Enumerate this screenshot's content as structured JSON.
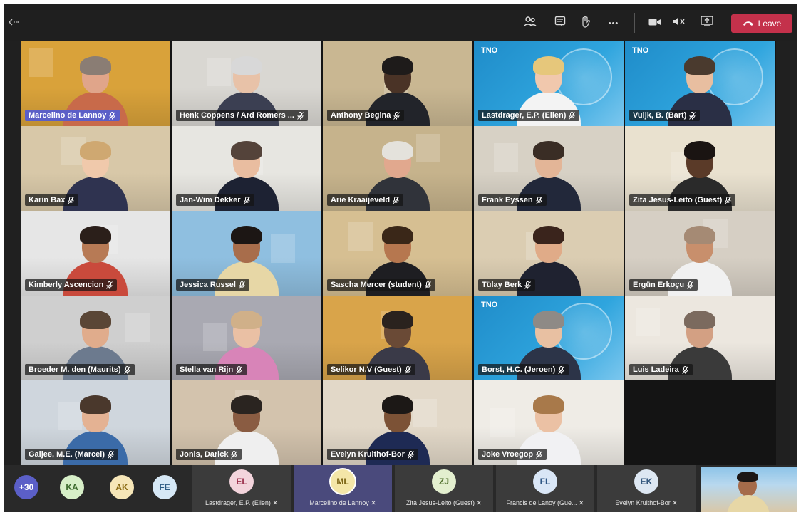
{
  "topbar": {
    "icons": [
      "participants-icon",
      "chat-icon",
      "raise-hand-icon",
      "more-options-icon",
      "camera-icon",
      "mute-icon",
      "share-screen-icon"
    ],
    "leave_label": "Leave",
    "more_glyph": "•••",
    "leave_color": "#c4314b"
  },
  "participants": [
    {
      "name": "Marcelino de Lannoy",
      "speaking": true,
      "bg": "#d9a23a",
      "skin": "#e0a58a",
      "hair": "#8a7d74",
      "shirt": "#c86a4a"
    },
    {
      "name": "Henk Coppens / Ard Romers ...",
      "bg": "#d9d7d2",
      "skin": "#e8c2a8",
      "hair": "#d8d8d8",
      "shirt": "#3b3f52"
    },
    {
      "name": "Anthony Begina",
      "bg": "#c9b792",
      "skin": "#4a3326",
      "hair": "#1e1b1a",
      "shirt": "#22242a"
    },
    {
      "name": "Lastdrager, E.P. (Ellen)",
      "bg": "#1f8cc9",
      "skin": "#f1c8ad",
      "hair": "#e6c77b",
      "shirt": "#f3f3f3",
      "tno": true
    },
    {
      "name": "Vuijk, B. (Bart)",
      "bg": "#1f8cc9",
      "skin": "#e8bea0",
      "hair": "#4a3a2e",
      "shirt": "#2a2f45",
      "tno": true
    },
    {
      "name": "Karin Bax",
      "bg": "#d8c8a8",
      "skin": "#f0c9ab",
      "hair": "#cfa871",
      "shirt": "#2f3350"
    },
    {
      "name": "Jan-Wim Dekker",
      "bg": "#e7e6e1",
      "skin": "#e9bda0",
      "hair": "#54433a",
      "shirt": "#1d2233"
    },
    {
      "name": "Arie Kraaijeveld",
      "bg": "#c6b38c",
      "skin": "#e1a88e",
      "hair": "#e4e2dc",
      "shirt": "#30333a"
    },
    {
      "name": "Frank Eyssen",
      "bg": "#d7d1c5",
      "skin": "#e3b597",
      "hair": "#3a2d25",
      "shirt": "#22283a"
    },
    {
      "name": "Zita Jesus-Leito (Guest)",
      "bg": "#e9e1cf",
      "skin": "#5a3a28",
      "hair": "#1a1412",
      "shirt": "#2a2a2a"
    },
    {
      "name": "Kimberly Ascencion",
      "bg": "#e6e6e6",
      "skin": "#b77a55",
      "hair": "#2b1f1a",
      "shirt": "#c94a3c"
    },
    {
      "name": "Jessica Russel",
      "bg": "#8fbfe0",
      "skin": "#a86d4b",
      "hair": "#1c1614",
      "shirt": "#e7d7a6"
    },
    {
      "name": "Sascha Mercer (student)",
      "bg": "#d6bf92",
      "skin": "#b6774f",
      "hair": "#3a2718",
      "shirt": "#1e1e22"
    },
    {
      "name": "Tülay Berk",
      "bg": "#dbcdb2",
      "skin": "#e0ab88",
      "hair": "#3a241c",
      "shirt": "#1f2230"
    },
    {
      "name": "Ergün Erkoçu",
      "bg": "#d6cfc4",
      "skin": "#c88f6c",
      "hair": "#a58a74",
      "shirt": "#f1f1f1"
    },
    {
      "name": "Broeder M. den (Maurits)",
      "bg": "#cfcfcf",
      "skin": "#e0ac8c",
      "hair": "#5a4636",
      "shirt": "#6c7a8e"
    },
    {
      "name": "Stella van Rijn",
      "bg": "#a9a9b2",
      "skin": "#eac0a4",
      "hair": "#d0b089",
      "shirt": "#d884b8"
    },
    {
      "name": "Selikor N.V (Guest)",
      "bg": "#d9a44a",
      "skin": "#6a4a36",
      "hair": "#2a221e",
      "shirt": "#3a3a48"
    },
    {
      "name": "Borst, H.C. (Jeroen)",
      "bg": "#1f8cc9",
      "skin": "#e8c0a2",
      "hair": "#8e8a86",
      "shirt": "#2c3448",
      "tno": true
    },
    {
      "name": "Luis Ladeira",
      "bg": "#ece7df",
      "skin": "#d3a083",
      "hair": "#7b6a5e",
      "shirt": "#3a3a3a"
    },
    {
      "name": "Galjee, M.E. (Marcel)",
      "bg": "#cfd6dd",
      "skin": "#e4b293",
      "hair": "#4a382c",
      "shirt": "#3b6ba8"
    },
    {
      "name": "Jonis, Darick",
      "bg": "#d3c3ad",
      "skin": "#8a5c42",
      "hair": "#2a2420",
      "shirt": "#efefef"
    },
    {
      "name": "Evelyn Kruithof-Bor",
      "bg": "#e2d8c8",
      "skin": "#7c5236",
      "hair": "#1c1816",
      "shirt": "#1e2a54"
    },
    {
      "name": "Joke Vroegop",
      "bg": "#efece6",
      "skin": "#ebc1a4",
      "hair": "#a8794a",
      "shirt": "#f1f1f3"
    }
  ],
  "bottombar": {
    "overflow_count": "+30",
    "small_avatars": [
      {
        "initials": "KA",
        "bg": "#d7efc8",
        "fg": "#3d6b2e"
      },
      {
        "initials": "AK",
        "bg": "#f6e6b8",
        "fg": "#8a6a12"
      },
      {
        "initials": "FE",
        "bg": "#d6e8f6",
        "fg": "#2c5a82"
      }
    ],
    "strip": [
      {
        "initials": "EL",
        "name": "Lastdrager, E.P. (Ellen)",
        "bg": "#f3d4dc",
        "fg": "#9a2e4a"
      },
      {
        "initials": "ML",
        "name": "Marcelino de Lannoy",
        "bg": "#f4e6a8",
        "fg": "#7a6212",
        "active": true
      },
      {
        "initials": "ZJ",
        "name": "Zita Jesus-Leito (Guest)",
        "bg": "#e3efcf",
        "fg": "#4e6e2a"
      },
      {
        "initials": "FL",
        "name": "Francis de Lanoy (Gue...",
        "bg": "#d9e6f6",
        "fg": "#2e5684"
      },
      {
        "initials": "EK",
        "name": "Evelyn Kruithof-Bor",
        "bg": "#dde7f2",
        "fg": "#34587e"
      }
    ]
  }
}
